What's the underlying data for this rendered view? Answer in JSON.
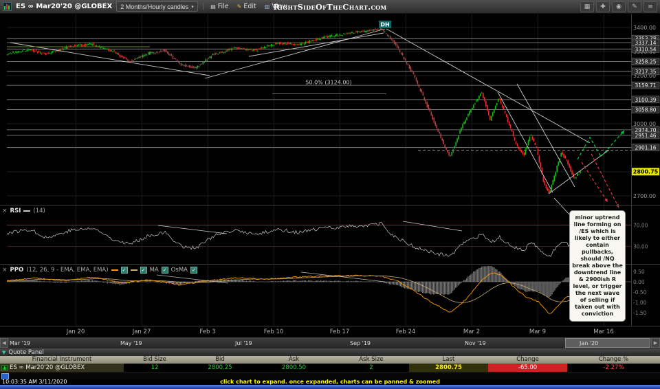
{
  "menu_bar": {
    "symbol_title": "ES ∞ Mar20'20 @GLOBEX",
    "timeframe_label": "2 Months/Hourly candles",
    "menus": [
      {
        "label": "File",
        "icon": "▤"
      },
      {
        "label": "Edit",
        "icon": "✎"
      },
      {
        "label": "View",
        "icon": "▥"
      }
    ],
    "brand": "RightSideOfTheChart.com",
    "tool_icons": [
      {
        "name": "layout-grid",
        "glyph": "▦"
      },
      {
        "name": "add-chart",
        "glyph": "✚"
      },
      {
        "name": "crosshair",
        "glyph": "◉"
      },
      {
        "name": "draw",
        "glyph": "✎"
      },
      {
        "name": "menu",
        "glyph": "≡"
      }
    ]
  },
  "ui_icons": {
    "close": "×",
    "caret_down": "▾",
    "scroll_left": "◀",
    "scroll_right": "▶",
    "collapse": "▼",
    "check": "✓"
  },
  "rsi": {
    "label": "RSI",
    "params": "(14)"
  },
  "ppo": {
    "label": "PPO",
    "params": "(12, 26, 9 - EMA, EMA, EMA)",
    "ma_label": "MA",
    "osma_label": "OsMA"
  },
  "timeline": {
    "labels": [
      "Mar '19",
      "May '19",
      "Jul '19",
      "Sep '19",
      "Nov '19",
      "Jan '20"
    ]
  },
  "quote_panel": {
    "title": "Quote Panel",
    "columns": [
      "Financial Instrument",
      "Bid Size",
      "Bid",
      "Ask",
      "Ask Size",
      "Last",
      "Change",
      "Change %"
    ],
    "rows": [
      {
        "instrument": "ES ∞ Mar20'20 @GLOBEX",
        "bid_size": "12",
        "bid": "2800.25",
        "ask": "2800.50",
        "ask_size": "2",
        "last": "2800.75",
        "change": "-65.00",
        "change_pct": "-2.27%"
      }
    ]
  },
  "status_bar": {
    "timestamp": "10:03:35 AM 3/11/2020",
    "hint": "click chart to expand. once expanded, charts can be panned & zoomed"
  },
  "chart_data": {
    "type": "candlestick",
    "title": "ES Mar20'20 @GLOBEX — 2 Months / Hourly candles",
    "annotation": "minor uptrend line forming on /ES which is likely to either contain pullbacks, should /NQ break above the downtrend line & 2900ish R level, or trigger the next wave of selling if taken out with conviction",
    "dh_label": "DH",
    "last_price": 2800.75,
    "y_axis_ticks": [
      3400,
      3300,
      3200,
      3100,
      3000,
      2900,
      2800,
      2700
    ],
    "support_resistance_levels": [
      3353.78,
      3337.14,
      3310.54,
      3258.25,
      3217.35,
      3159.71,
      3100.39,
      3058.8,
      2974.7,
      2951.46,
      2901.16
    ],
    "dashed_resistance_price": 2890,
    "fib_level": {
      "label": "50.0% (3124.00)",
      "price": 3124.0
    },
    "x_labels": [
      "Jan 20",
      "Jan 27",
      "Feb 3",
      "Feb 10",
      "Feb 17",
      "Feb 24",
      "Mar 2",
      "Mar 9",
      "Mar 16"
    ],
    "x_gridlines": [
      110,
      206,
      302,
      398,
      494,
      590,
      686,
      782,
      878
    ],
    "price_anchors": [
      [
        0.0,
        3290
      ],
      [
        0.04,
        3308
      ],
      [
        0.07,
        3290
      ],
      [
        0.11,
        3322
      ],
      [
        0.15,
        3330
      ],
      [
        0.185,
        3302
      ],
      [
        0.215,
        3260
      ],
      [
        0.245,
        3290
      ],
      [
        0.275,
        3305
      ],
      [
        0.305,
        3245
      ],
      [
        0.33,
        3232
      ],
      [
        0.36,
        3288
      ],
      [
        0.4,
        3315
      ],
      [
        0.435,
        3305
      ],
      [
        0.47,
        3335
      ],
      [
        0.51,
        3328
      ],
      [
        0.55,
        3358
      ],
      [
        0.59,
        3375
      ],
      [
        0.625,
        3385
      ],
      [
        0.652,
        3396
      ],
      [
        0.67,
        3355
      ],
      [
        0.69,
        3285
      ],
      [
        0.712,
        3190
      ],
      [
        0.733,
        3075
      ],
      [
        0.755,
        2955
      ],
      [
        0.773,
        2860
      ],
      [
        0.793,
        2985
      ],
      [
        0.812,
        3070
      ],
      [
        0.828,
        3134
      ],
      [
        0.843,
        3015
      ],
      [
        0.858,
        3110
      ],
      [
        0.872,
        3025
      ],
      [
        0.888,
        2915
      ],
      [
        0.902,
        2870
      ],
      [
        0.913,
        2958
      ],
      [
        0.924,
        2895
      ],
      [
        0.936,
        2755
      ],
      [
        0.946,
        2712
      ],
      [
        0.956,
        2792
      ],
      [
        0.967,
        2882
      ],
      [
        0.978,
        2835
      ],
      [
        0.989,
        2772
      ],
      [
        1.0,
        2800
      ]
    ],
    "rsi": {
      "period": 14,
      "levels": [
        70,
        30
      ],
      "anchors": [
        [
          0.0,
          55
        ],
        [
          0.04,
          62
        ],
        [
          0.07,
          46
        ],
        [
          0.11,
          60
        ],
        [
          0.15,
          64
        ],
        [
          0.185,
          44
        ],
        [
          0.215,
          34
        ],
        [
          0.245,
          50
        ],
        [
          0.275,
          56
        ],
        [
          0.305,
          30
        ],
        [
          0.33,
          27
        ],
        [
          0.36,
          50
        ],
        [
          0.4,
          60
        ],
        [
          0.435,
          52
        ],
        [
          0.47,
          62
        ],
        [
          0.51,
          56
        ],
        [
          0.55,
          64
        ],
        [
          0.59,
          67
        ],
        [
          0.625,
          69
        ],
        [
          0.652,
          72
        ],
        [
          0.67,
          52
        ],
        [
          0.69,
          40
        ],
        [
          0.712,
          28
        ],
        [
          0.733,
          21
        ],
        [
          0.755,
          15
        ],
        [
          0.773,
          13
        ],
        [
          0.793,
          34
        ],
        [
          0.812,
          44
        ],
        [
          0.828,
          52
        ],
        [
          0.843,
          36
        ],
        [
          0.858,
          47
        ],
        [
          0.872,
          37
        ],
        [
          0.888,
          27
        ],
        [
          0.902,
          24
        ],
        [
          0.913,
          37
        ],
        [
          0.924,
          29
        ],
        [
          0.936,
          15
        ],
        [
          0.946,
          12
        ],
        [
          0.956,
          27
        ],
        [
          0.967,
          42
        ],
        [
          0.978,
          34
        ],
        [
          0.989,
          27
        ],
        [
          1.0,
          35
        ]
      ]
    },
    "ppo": {
      "axis_ticks": [
        0.5,
        0,
        -0.5,
        -1,
        -1.5
      ],
      "anchors": [
        [
          0.0,
          0.05
        ],
        [
          0.05,
          0.18
        ],
        [
          0.1,
          0.05
        ],
        [
          0.15,
          0.22
        ],
        [
          0.2,
          -0.05
        ],
        [
          0.25,
          0.1
        ],
        [
          0.3,
          -0.15
        ],
        [
          0.35,
          0.05
        ],
        [
          0.4,
          0.2
        ],
        [
          0.45,
          0.12
        ],
        [
          0.5,
          0.22
        ],
        [
          0.55,
          0.28
        ],
        [
          0.6,
          0.3
        ],
        [
          0.652,
          0.28
        ],
        [
          0.68,
          0.05
        ],
        [
          0.71,
          -0.45
        ],
        [
          0.74,
          -1.0
        ],
        [
          0.773,
          -1.5
        ],
        [
          0.8,
          -0.85
        ],
        [
          0.828,
          0.1
        ],
        [
          0.845,
          0.45
        ],
        [
          0.862,
          0.3
        ],
        [
          0.885,
          -0.3
        ],
        [
          0.905,
          -0.75
        ],
        [
          0.925,
          -0.95
        ],
        [
          0.946,
          -1.6
        ],
        [
          0.962,
          -1.1
        ],
        [
          0.975,
          -0.7
        ],
        [
          1.0,
          -0.9
        ]
      ]
    },
    "overlays": {
      "trendlines": [
        [
          15,
          42,
          305,
          90,
          "#cccccc"
        ],
        [
          10,
          48,
          218,
          48,
          "#6b8e23"
        ],
        [
          298,
          94,
          560,
          22,
          "#cccccc"
        ],
        [
          362,
          62,
          558,
          28,
          "#cccccc"
        ],
        [
          562,
          22,
          858,
          188,
          "#cccccc"
        ],
        [
          724,
          114,
          804,
          260,
          "#cccccc"
        ],
        [
          752,
          102,
          836,
          252,
          "#cccccc"
        ],
        [
          798,
          262,
          886,
          198,
          "#cccccc"
        ]
      ],
      "projection_up": [
        [
          840,
          212
        ],
        [
          858,
          180
        ],
        [
          874,
          208
        ],
        [
          908,
          170
        ]
      ],
      "projection_down": [
        [
          [
            846,
            216
          ],
          [
            884,
            274
          ]
        ],
        [
          [
            860,
            204
          ],
          [
            900,
            282
          ]
        ]
      ],
      "rsi_lines": [
        [
          230,
          308,
          330,
          320
        ],
        [
          586,
          302,
          672,
          316
        ]
      ],
      "ppo_lines": [
        [
          228,
          380,
          332,
          392
        ],
        [
          438,
          376,
          560,
          390
        ]
      ],
      "callout_line": [
        [
          828,
          292
        ],
        [
          806,
          268
        ]
      ]
    },
    "colors": {
      "up": "#1db61d",
      "down": "#e03232",
      "ppo_line": "#ff9900",
      "signal_line": "#c8b070",
      "trendline": "#cccccc",
      "projection_up": "#00cc44",
      "projection_down": "#e03345"
    }
  }
}
